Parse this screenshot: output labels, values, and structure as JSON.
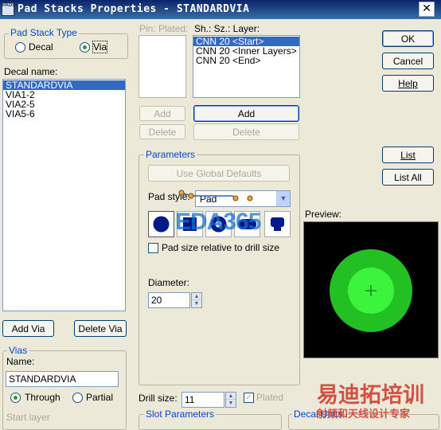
{
  "window": {
    "title": "Pad Stacks Properties - STANDARDVIA",
    "app_icon_text": "PADS",
    "close_glyph": "✕"
  },
  "pad_stack_type": {
    "label": "Pad Stack Type",
    "options": [
      {
        "label": "Decal",
        "selected": false
      },
      {
        "label": "Via",
        "selected": true
      }
    ]
  },
  "decal_name": {
    "label": "Decal name:",
    "items": [
      "STANDARDVIA",
      "VIA1-2",
      "VIA2-5",
      "VIA5-6"
    ],
    "selected_index": 0
  },
  "via_buttons": {
    "add": "Add Via",
    "delete": "Delete Via"
  },
  "vias": {
    "label": "Vias",
    "name_label": "Name:",
    "name_value": "STANDARDVIA",
    "through_label": "Through",
    "partial_label": "Partial",
    "through_selected": true,
    "start_layer_label": "Start layer"
  },
  "pins": {
    "header": "Pin: Plated:",
    "add": "Add",
    "delete": "Delete"
  },
  "layers": {
    "header": "Sh.: Sz.: Layer:",
    "items": [
      "CNN 20 <Start>",
      "CNN 20 <Inner Layers>",
      "CNN 20 <End>"
    ],
    "selected_index": 0,
    "add": "Add",
    "delete": "Delete"
  },
  "parameters": {
    "label": "Parameters",
    "use_global": "Use Global Defaults",
    "pad_style_label": "Pad style:",
    "pad_style_value": "Pad",
    "shape_icons": [
      "round-pad-icon",
      "square-pad-icon",
      "annular-pad-icon",
      "oval-pad-icon",
      "thermal-pad-icon"
    ],
    "relative_label": "Pad size relative to drill size",
    "relative_checked": false,
    "diameter_label": "Diameter:",
    "diameter_value": "20"
  },
  "drill": {
    "label": "Drill size:",
    "value": "11",
    "plated_label": "Plated",
    "plated_checked": true
  },
  "slot_parameters": {
    "label": "Slot Parameters"
  },
  "decal_units": {
    "label": "Decal Units"
  },
  "preview": {
    "label": "Preview:",
    "pad_color": "#22c022",
    "hole_color": "#3cf43c",
    "background": "#000000"
  },
  "actions": {
    "ok": "OK",
    "cancel": "Cancel",
    "help": "Help",
    "list": "List",
    "list_all": "List All"
  },
  "watermarks": {
    "eda": "EDA365",
    "cn_brand": "易迪拓培训",
    "cn_sub": "射频和天线设计专家"
  },
  "colors": {
    "accent": "#0046d5",
    "selection": "#316ac5",
    "title_bar": "#0a246a"
  }
}
